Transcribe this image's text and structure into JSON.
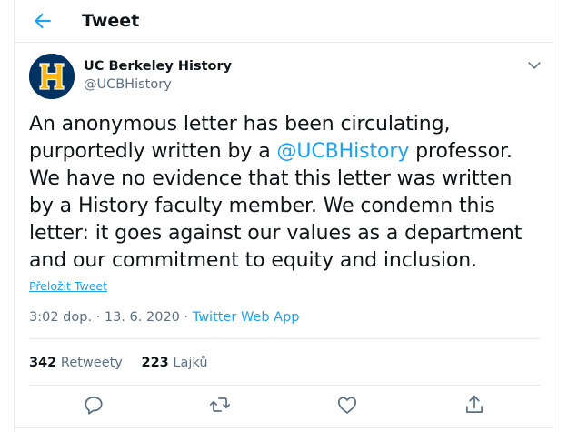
{
  "header": {
    "title": "Tweet",
    "back_icon": "arrow-left-icon"
  },
  "colors": {
    "accent": "#1da1f2",
    "secondary_text": "#5b7083",
    "avatar_bg": "#003262",
    "avatar_letter": "#fdb515"
  },
  "tweet": {
    "author_name": "UC Berkeley History",
    "author_handle": "@UCBHistory",
    "avatar_letter": "H",
    "text_before": "An anonymous letter has been circulating, purportedly written by a ",
    "mention": "@UCBHistory",
    "text_after": " professor. We have no evidence that this letter was written by a History faculty member. We condemn this letter: it goes against our values as a department and our commitment to equity and inclusion.",
    "translate_label": "Přeložit Tweet",
    "time": "3:02 dop.",
    "date": "13. 6. 2020",
    "separator": "·",
    "source": "Twitter Web App"
  },
  "stats": {
    "retweets_count": "342",
    "retweets_label": "Retweety",
    "likes_count": "223",
    "likes_label": "Lajků"
  },
  "actions": [
    "reply-icon",
    "retweet-icon",
    "like-icon",
    "share-icon"
  ]
}
